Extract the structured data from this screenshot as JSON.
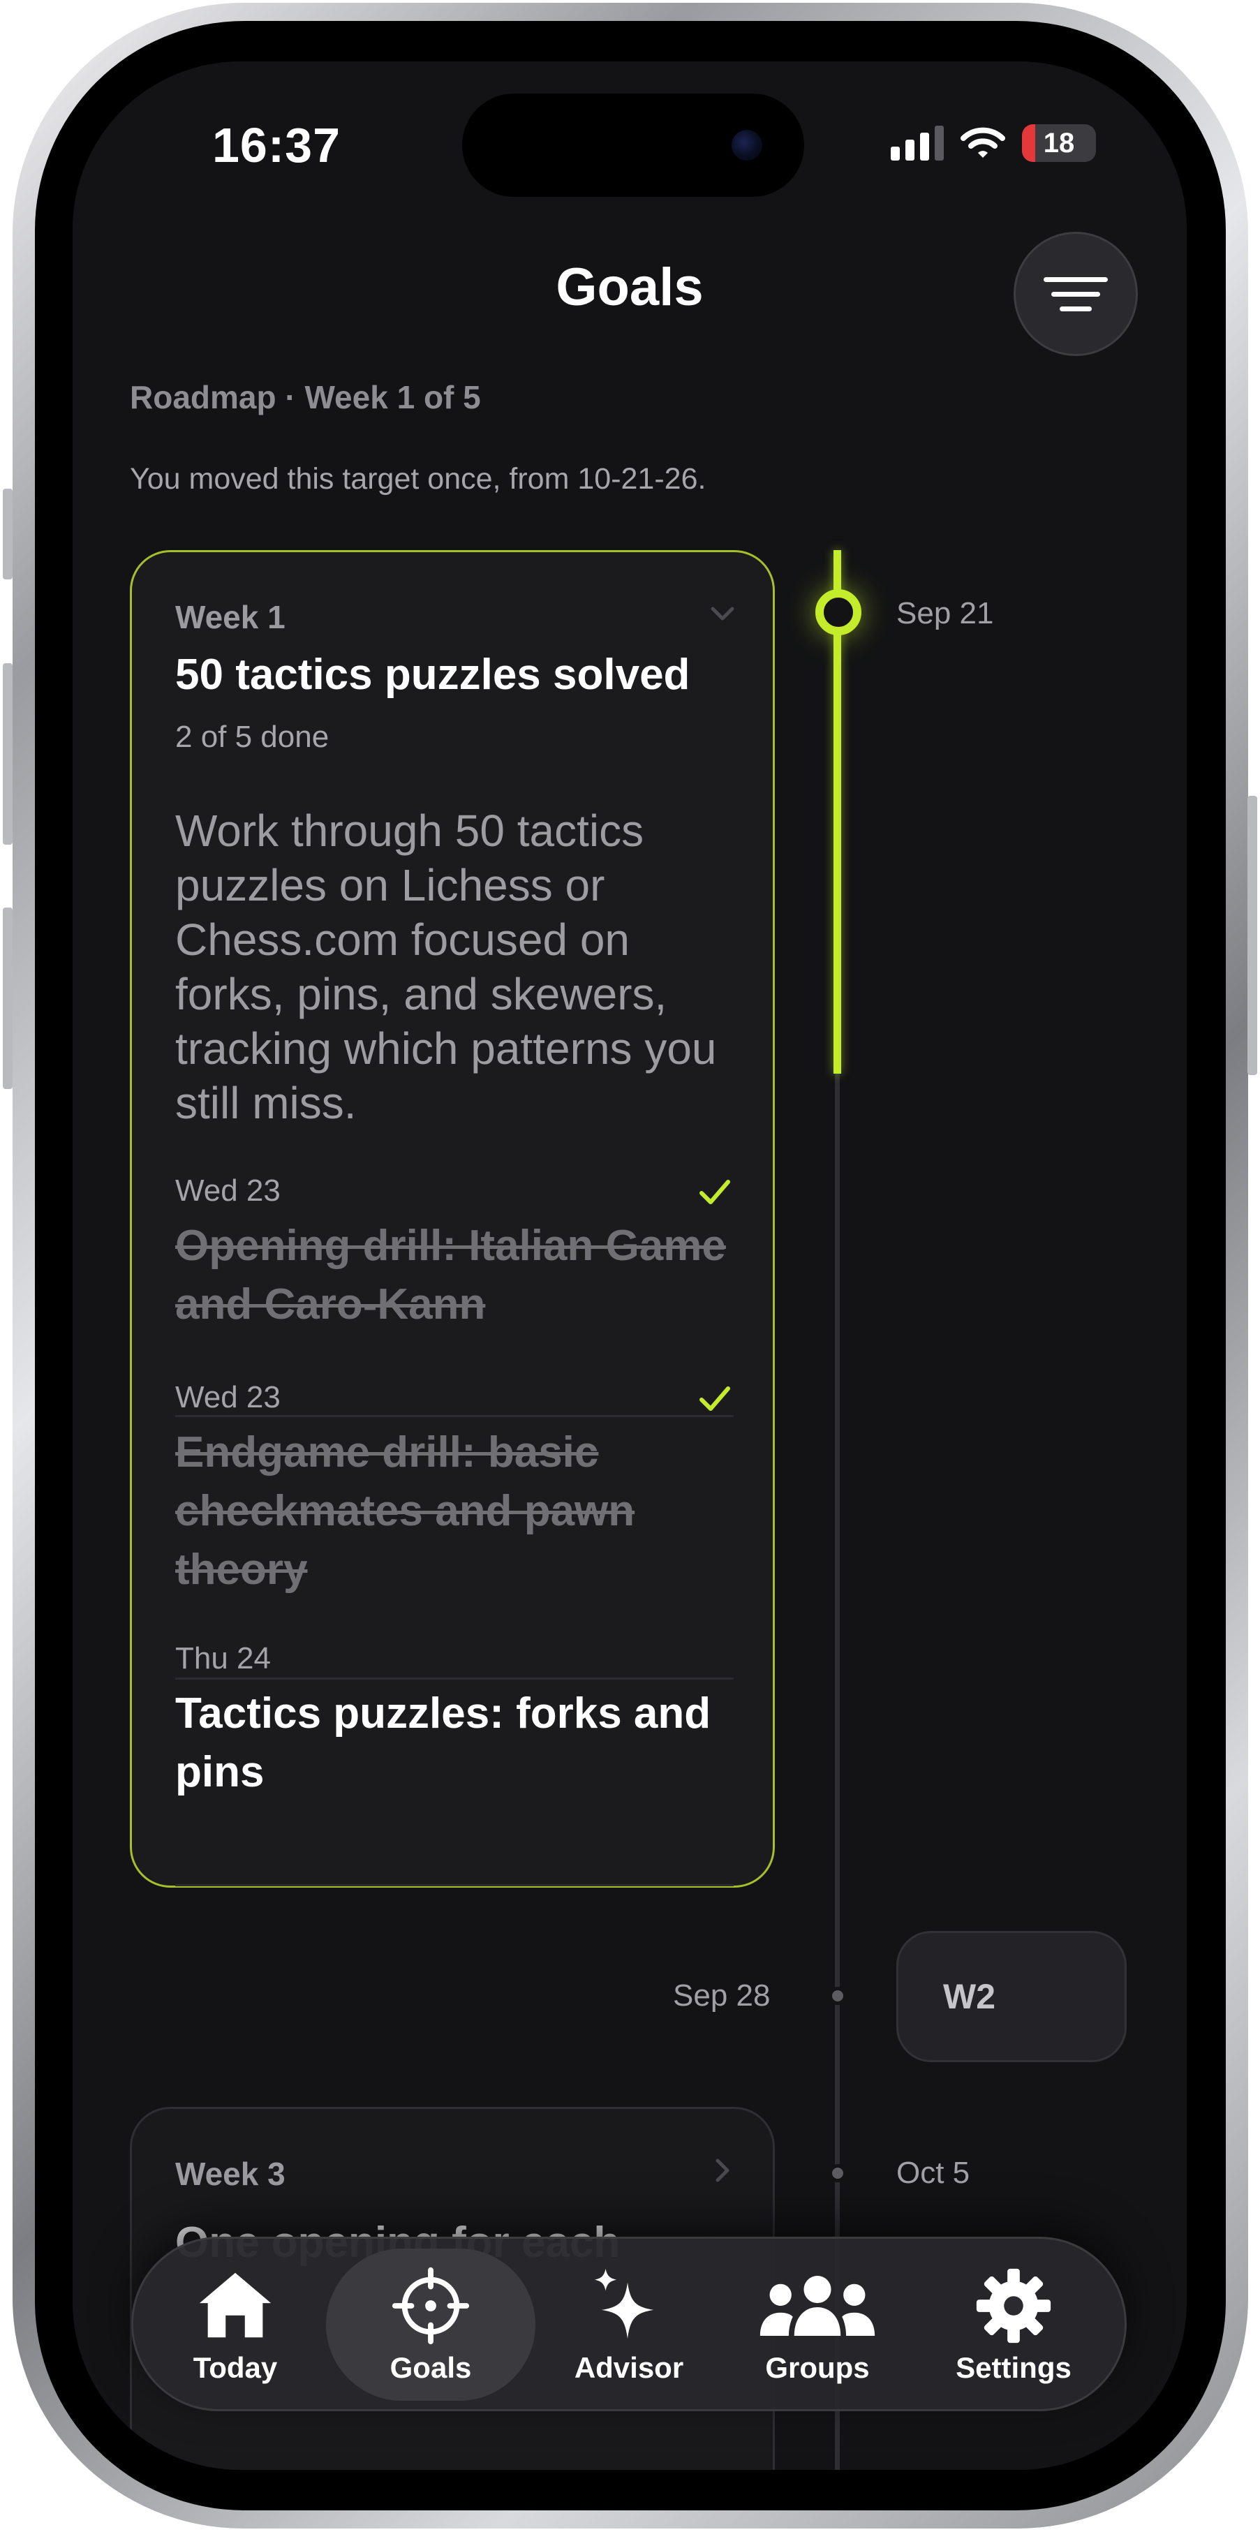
{
  "status_bar": {
    "time": "16:37",
    "battery_level": "18",
    "battery_fraction": 0.18,
    "signal_bars": 3,
    "signal_bars_total": 4
  },
  "header": {
    "title": "Goals",
    "menu_icon": "menu-lines-icon"
  },
  "roadmap_label": "Roadmap · Week 1 of 5",
  "moved_note": "You moved this target once, from 10-21-26.",
  "timeline": {
    "dates": [
      "Sep 21",
      "Sep 28",
      "Oct 5"
    ],
    "active_color": "#c4ec2a"
  },
  "week1": {
    "label": "Week 1",
    "title": "50 tactics puzzles solved",
    "progress": "2 of 5 done",
    "description": "Work through 50 tactics puzzles on Lichess or Chess.com focused on forks, pins, and skewers, tracking which patterns you still miss.",
    "tasks": [
      {
        "day": "Wed 23",
        "title": "Opening drill: Italian Game and Caro-Kann",
        "done": true
      },
      {
        "day": "Wed 23",
        "title": "Endgame drill: basic checkmates and pawn theory",
        "done": true
      },
      {
        "day": "Thu 24",
        "title": "Tactics puzzles: forks and pins",
        "done": false
      }
    ]
  },
  "week2_chip": "W2",
  "week3": {
    "label": "Week 3",
    "title": "One opening for each"
  },
  "tabs": [
    {
      "label": "Today",
      "icon": "home-icon",
      "active": false
    },
    {
      "label": "Goals",
      "icon": "target-icon",
      "active": true
    },
    {
      "label": "Advisor",
      "icon": "sparkle-icon",
      "active": false
    },
    {
      "label": "Groups",
      "icon": "people-icon",
      "active": false
    },
    {
      "label": "Settings",
      "icon": "gear-icon",
      "active": false
    }
  ],
  "colors": {
    "accent": "#c4ec2a",
    "background": "#131315",
    "card": "#1b1b1e",
    "battery_low": "#e5383b"
  }
}
